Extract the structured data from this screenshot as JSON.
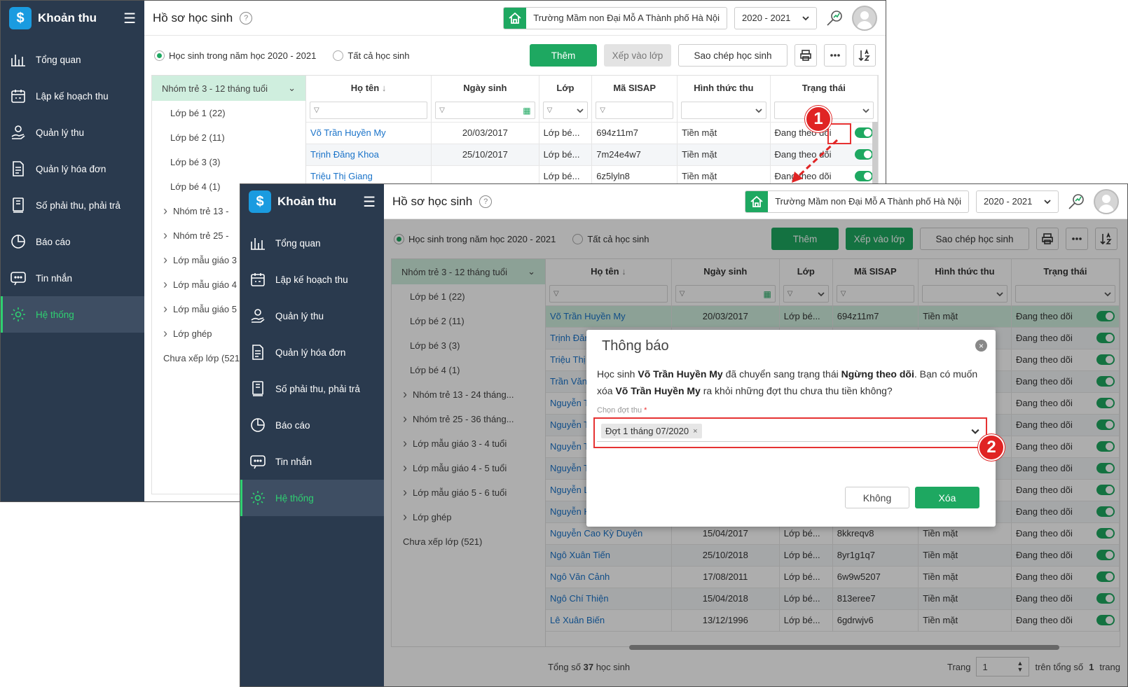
{
  "app_name": "Khoản thu",
  "menu": [
    {
      "label": "Tổng quan",
      "icon": "chart-bars-icon"
    },
    {
      "label": "Lập kế hoạch thu",
      "icon": "calendar-icon"
    },
    {
      "label": "Quản lý thu",
      "icon": "money-hand-icon"
    },
    {
      "label": "Quản lý hóa đơn",
      "icon": "invoice-icon"
    },
    {
      "label": "Số phải thu, phải trả",
      "icon": "ledger-icon"
    },
    {
      "label": "Báo cáo",
      "icon": "pie-chart-icon"
    },
    {
      "label": "Tin nhắn",
      "icon": "message-icon"
    },
    {
      "label": "Hệ thống",
      "icon": "gear-icon"
    }
  ],
  "page_title": "Hồ sơ học sinh",
  "help_glyph": "?",
  "school": "Trường Mầm non Đại Mỗ A Thành phố Hà Nội",
  "year": "2020 - 2021",
  "radio_current": "Học sinh trong năm học 2020 - 2021",
  "radio_all": "Tất cả học sinh",
  "btn_add": "Thêm",
  "btn_assign": "Xếp vào lớp",
  "btn_copy": "Sao chép học sinh",
  "tree_head": "Nhóm trẻ 3 - 12 tháng tuổi",
  "tree_w1": [
    {
      "label": "Lớp bé 1 (22)",
      "type": "leaf"
    },
    {
      "label": "Lớp bé 2 (11)",
      "type": "leaf"
    },
    {
      "label": "Lớp bé 3 (3)",
      "type": "leaf"
    },
    {
      "label": "Lớp bé 4 (1)",
      "type": "leaf"
    },
    {
      "label": "Nhóm trẻ 13 -",
      "type": "grp"
    },
    {
      "label": "Nhóm trẻ 25 -",
      "type": "grp"
    },
    {
      "label": "Lớp mẫu giáo 3",
      "type": "grp"
    },
    {
      "label": "Lớp mẫu giáo 4",
      "type": "grp"
    },
    {
      "label": "Lớp mẫu giáo 5",
      "type": "grp"
    },
    {
      "label": "Lớp ghép",
      "type": "grp"
    },
    {
      "label": "Chưa xếp lớp (521",
      "type": "root"
    }
  ],
  "tree_w2": [
    {
      "label": "Lớp bé 1 (22)",
      "type": "leaf"
    },
    {
      "label": "Lớp bé 2 (11)",
      "type": "leaf"
    },
    {
      "label": "Lớp bé 3 (3)",
      "type": "leaf"
    },
    {
      "label": "Lớp bé 4 (1)",
      "type": "leaf"
    },
    {
      "label": "Nhóm trẻ 13 - 24 tháng...",
      "type": "grp"
    },
    {
      "label": "Nhóm trẻ 25 - 36 tháng...",
      "type": "grp"
    },
    {
      "label": "Lớp mẫu giáo 3 - 4 tuổi",
      "type": "grp"
    },
    {
      "label": "Lớp mẫu giáo 4 - 5 tuổi",
      "type": "grp"
    },
    {
      "label": "Lớp mẫu giáo 5 - 6 tuổi",
      "type": "grp"
    },
    {
      "label": "Lớp ghép",
      "type": "grp"
    },
    {
      "label": "Chưa xếp lớp (521)",
      "type": "root"
    }
  ],
  "columns": [
    "Họ tên",
    "Ngày sinh",
    "Lớp",
    "Mã SISAP",
    "Hình thức thu",
    "Trạng thái"
  ],
  "sort_arrow": "↓",
  "filter_glyph": "▽",
  "rows_w1": [
    {
      "name": "Võ Trần Huyền My",
      "dob": "20/03/2017",
      "cls": "Lớp bé...",
      "code": "694z11m7",
      "method": "Tiền mặt",
      "status": "Đang theo dõi"
    },
    {
      "name": "Trịnh Đăng Khoa",
      "dob": "25/10/2017",
      "cls": "Lớp bé...",
      "code": "7m24e4w7",
      "method": "Tiền mặt",
      "status": "Đang theo dõi"
    },
    {
      "name": "Triệu Thị Giang",
      "dob": "",
      "cls": "Lớp bé...",
      "code": "6z5lyln8",
      "method": "Tiền mặt",
      "status": "Đang theo dõi"
    }
  ],
  "rows_w2": [
    {
      "name": "Võ Trần Huyền My",
      "dob": "20/03/2017",
      "cls": "Lớp bé...",
      "code": "694z11m7",
      "method": "Tiền mặt",
      "status": "Đang theo dõi"
    },
    {
      "name": "Trịnh Đăng Khoa",
      "dob": "25/10/2017",
      "cls": "Lớp bé...",
      "code": "7m24e4w7",
      "method": "Tiền mặt",
      "status": "Đang theo dõi"
    },
    {
      "name": "Triệu Thị Giang",
      "dob": "",
      "cls": "Lớp bé...",
      "code": "6z5lyln8",
      "method": "Tiền mặt",
      "status": "Đang theo dõi"
    },
    {
      "name": "Trần Văn Nam",
      "dob": "",
      "cls": "",
      "code": "",
      "method": "",
      "status": "Đang theo dõi"
    },
    {
      "name": "Nguyễn Tiến",
      "dob": "",
      "cls": "",
      "code": "",
      "method": "",
      "status": "Đang theo dõi"
    },
    {
      "name": "Nguyễn Thị",
      "dob": "",
      "cls": "",
      "code": "",
      "method": "",
      "status": "Đang theo dõi"
    },
    {
      "name": "Nguyễn Thị",
      "dob": "",
      "cls": "",
      "code": "",
      "method": "",
      "status": "Đang theo dõi"
    },
    {
      "name": "Nguyễn Thị",
      "dob": "",
      "cls": "",
      "code": "",
      "method": "",
      "status": "Đang theo dõi"
    },
    {
      "name": "Nguyễn Lê",
      "dob": "",
      "cls": "",
      "code": "",
      "method": "",
      "status": "Đang theo dõi"
    },
    {
      "name": "Nguyễn Hồ",
      "dob": "",
      "cls": "",
      "code": "",
      "method": "",
      "status": "Đang theo dõi"
    },
    {
      "name": "Nguyễn Cao Kỳ Duyên",
      "dob": "15/04/2017",
      "cls": "Lớp bé...",
      "code": "8kkreqv8",
      "method": "Tiền mặt",
      "status": "Đang theo dõi"
    },
    {
      "name": "Ngô Xuân Tiến",
      "dob": "25/10/2018",
      "cls": "Lớp bé...",
      "code": "8yr1g1q7",
      "method": "Tiền mặt",
      "status": "Đang theo dõi"
    },
    {
      "name": "Ngô Văn Cảnh",
      "dob": "17/08/2011",
      "cls": "Lớp bé...",
      "code": "6w9w5207",
      "method": "Tiền mặt",
      "status": "Đang theo dõi"
    },
    {
      "name": "Ngô Chí Thiện",
      "dob": "15/04/2018",
      "cls": "Lớp bé...",
      "code": "813eree7",
      "method": "Tiền mặt",
      "status": "Đang theo dõi"
    },
    {
      "name": "Lê Xuân Biến",
      "dob": "13/12/1996",
      "cls": "Lớp bé...",
      "code": "6gdrwjv6",
      "method": "Tiền mặt",
      "status": "Đang theo dõi"
    }
  ],
  "footer": {
    "prefix": "Tổng số",
    "total": "37",
    "suffix": "học sinh",
    "page_label": "Trang",
    "page": "1",
    "page_total_text": "trên tổng số",
    "page_total": "1",
    "page_total_suffix": "trang"
  },
  "modal": {
    "title": "Thông báo",
    "close_glyph": "×",
    "msg_1": "Học sinh",
    "student": "Võ Trần Huyền My",
    "msg_2": "đã chuyển sang trạng thái",
    "new_status": "Ngừng theo dõi",
    "msg_3": ". Bạn có muốn xóa",
    "msg_4": "ra khỏi những đợt thu chưa thu tiền không?",
    "field_label": "Chọn đợt thu",
    "required_mark": "*",
    "chip": "Đợt 1 tháng 07/2020",
    "chip_remove": "×",
    "btn_no": "Không",
    "btn_yes": "Xóa"
  },
  "callouts": [
    "1",
    "2"
  ],
  "colors": {
    "sidebar": "#2a3a4e",
    "accent": "#1ea861",
    "active_menu": "#2fd071",
    "link": "#1a73c9",
    "callout": "#e02424"
  }
}
